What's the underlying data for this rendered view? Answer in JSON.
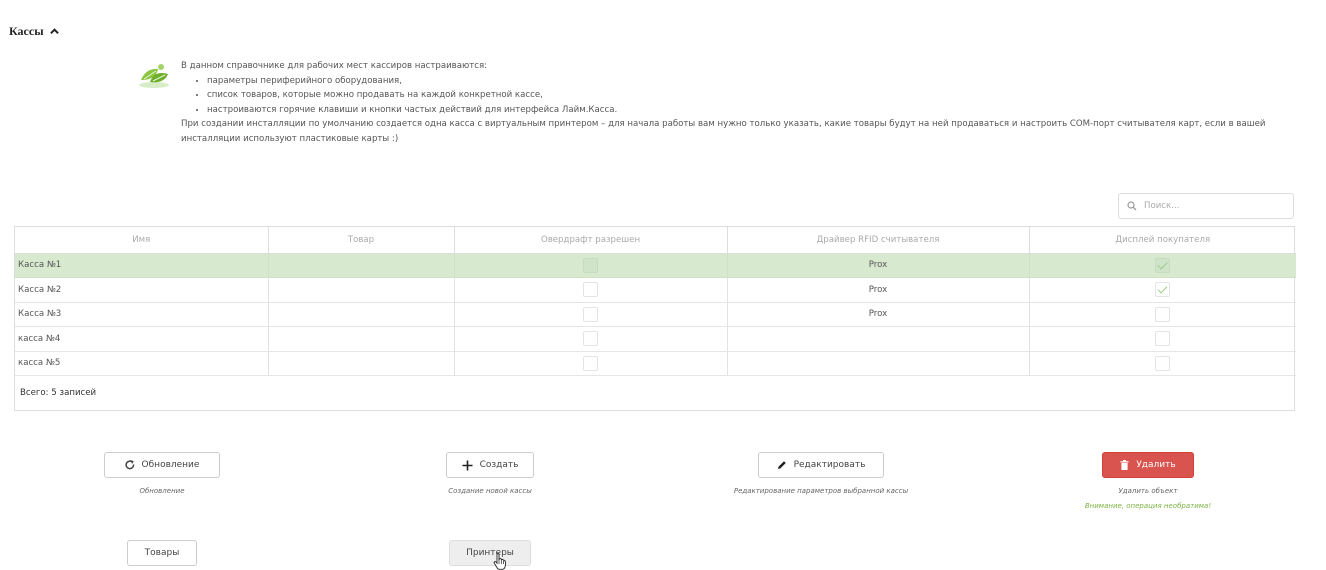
{
  "section": {
    "title": "Кассы",
    "icon": "chevron-up-icon"
  },
  "intro": {
    "lead": "В данном справочнике для рабочих мест кассиров настраиваются:",
    "items": [
      "параметры периферийного оборудования,",
      "список товаров, которые можно продавать на каждой конкретной кассе,",
      "настроиваются горячие клавиши и кнопки частых действий для интерфейса Лайм.Касса."
    ],
    "note": "При создании инсталляции по умолчанию создается одна касса с виртуальным принтером – для начала работы вам нужно только указать, какие товары будут на ней продаваться и настроить COM-порт считывателя карт, если в вашей инсталляции используют пластиковые карты :)"
  },
  "search": {
    "placeholder": "Поиск..."
  },
  "table": {
    "columns": [
      "Имя",
      "Товар",
      "Овердрафт разрешен",
      "Драйвер RFID считывателя",
      "Дисплей покупателя"
    ],
    "rows": [
      {
        "name": "Касса №1",
        "product": "",
        "overdraft": false,
        "rfid": "Prox",
        "display": true,
        "selected": true
      },
      {
        "name": "Касса №2",
        "product": "",
        "overdraft": false,
        "rfid": "Prox",
        "display": true,
        "selected": false
      },
      {
        "name": "Касса №3",
        "product": "",
        "overdraft": false,
        "rfid": "Prox",
        "display": false,
        "selected": false
      },
      {
        "name": "касса №4",
        "product": "",
        "overdraft": false,
        "rfid": "",
        "display": false,
        "selected": false
      },
      {
        "name": "касса №5",
        "product": "",
        "overdraft": false,
        "rfid": "",
        "display": false,
        "selected": false
      }
    ],
    "total": "Всего: 5 записей"
  },
  "actions": {
    "refresh": {
      "label": "Обновление",
      "hint": "Обновление"
    },
    "create": {
      "label": "Создать",
      "hint": "Создание новой кассы"
    },
    "edit": {
      "label": "Редактировать",
      "hint": "Редактирование параметров выбранной кассы"
    },
    "delete": {
      "label": "Удалить",
      "hint": "Удалить объект",
      "warning": "Внимание, операция необратима!"
    },
    "products": {
      "label": "Товары"
    },
    "printers": {
      "label": "Принтеры"
    }
  },
  "colors": {
    "selected_row": "#d7ead0",
    "danger": "#d9534f",
    "warning_text": "#7cb342"
  }
}
